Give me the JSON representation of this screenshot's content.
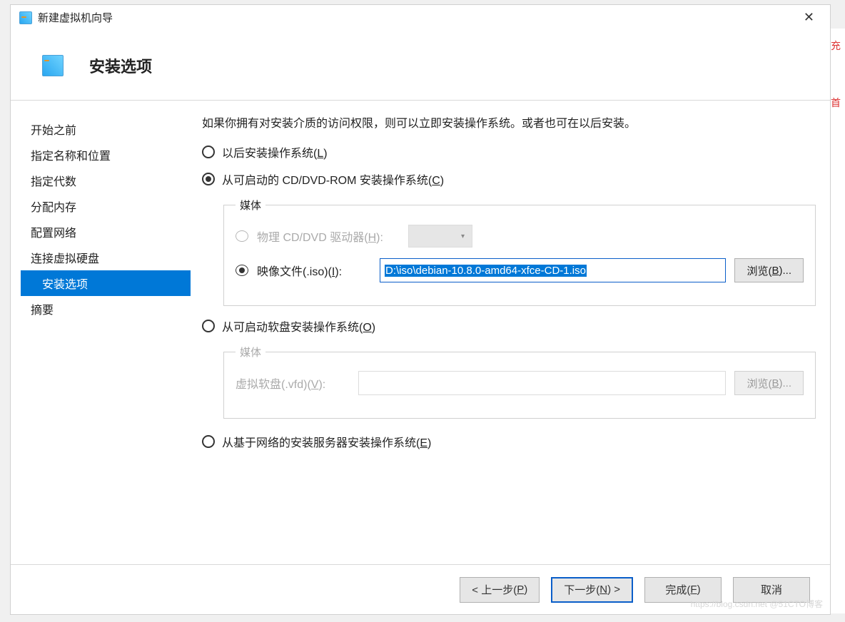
{
  "window": {
    "title": "新建虚拟机向导"
  },
  "header": {
    "heading": "安装选项"
  },
  "sidebar": {
    "items": [
      "开始之前",
      "指定名称和位置",
      "指定代数",
      "分配内存",
      "配置网络",
      "连接虚拟硬盘",
      "安装选项",
      "摘要"
    ]
  },
  "content": {
    "description": "如果你拥有对安装介质的访问权限，则可以立即安装操作系统。或者也可在以后安装。",
    "opt_later": {
      "pre": "以后安装操作系统(",
      "key": "L",
      "post": ")"
    },
    "opt_cd": {
      "pre": "从可启动的 CD/DVD-ROM 安装操作系统(",
      "key": "C",
      "post": ")"
    },
    "media_legend": "媒体",
    "physical": {
      "pre": "物理 CD/DVD 驱动器(",
      "key": "H",
      "post": "):"
    },
    "isofile": {
      "pre": "映像文件(.iso)(",
      "key": "I",
      "post": "):"
    },
    "iso_value": "D:\\iso\\debian-10.8.0-amd64-xfce-CD-1.iso",
    "browse": {
      "pre": "浏览(",
      "key": "B",
      "post": ")..."
    },
    "opt_floppy": {
      "pre": "从可启动软盘安装操作系统(",
      "key": "O",
      "post": ")"
    },
    "floppy_legend": "媒体",
    "vfd": {
      "pre": "虚拟软盘(.vfd)(",
      "key": "V",
      "post": "):"
    },
    "browse2": {
      "pre": "浏览(",
      "key": "B",
      "post": ")..."
    },
    "opt_net": {
      "pre": "从基于网络的安装服务器安装操作系统(",
      "key": "E",
      "post": ")"
    }
  },
  "footer": {
    "prev": {
      "pre": "< 上一步(",
      "key": "P",
      "post": ")"
    },
    "next": {
      "pre": "下一步(",
      "key": "N",
      "post": ") >"
    },
    "finish": {
      "pre": "完成(",
      "key": "F",
      "post": ")"
    },
    "cancel": "取消"
  },
  "watermark": "https://blog.csdn.net @51CTO博客",
  "edge": {
    "chong": "充",
    "shou": "首"
  }
}
